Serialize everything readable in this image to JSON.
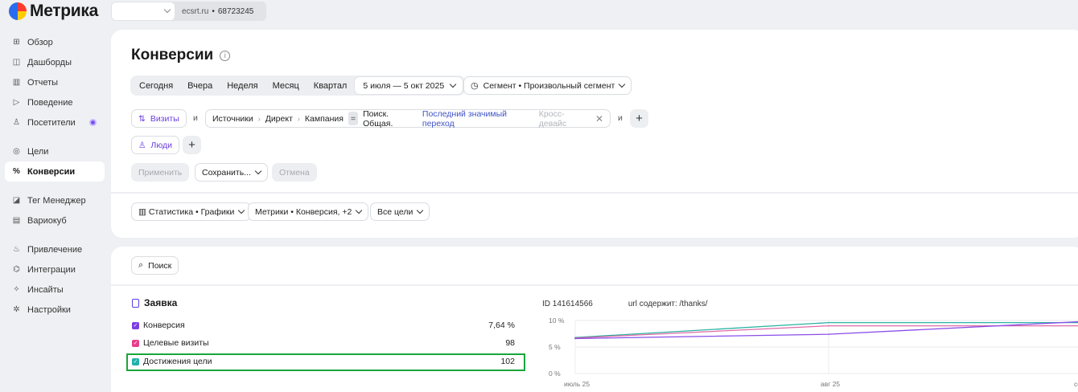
{
  "app": {
    "title": "Метрика"
  },
  "counter": {
    "site": "ecsrt.ru",
    "id": "68723245"
  },
  "sidebar": {
    "items": [
      {
        "label": "Обзор",
        "icon": "grid-icon"
      },
      {
        "label": "Дашборды",
        "icon": "dashboard-icon"
      },
      {
        "label": "Отчеты",
        "icon": "bar-chart-icon"
      },
      {
        "label": "Поведение",
        "icon": "play-icon"
      },
      {
        "label": "Посетители",
        "icon": "user-icon"
      },
      {
        "label": "Цели",
        "icon": "target-icon"
      },
      {
        "label": "Конверсии",
        "icon": "percent-icon",
        "active": true
      },
      {
        "label": "Тег Менеджер",
        "icon": "tag-icon"
      },
      {
        "label": "Вариокуб",
        "icon": "cube-icon"
      },
      {
        "label": "Привлечение",
        "icon": "fire-icon"
      },
      {
        "label": "Интеграции",
        "icon": "puzzle-icon"
      },
      {
        "label": "Инсайты",
        "icon": "sparkle-icon"
      },
      {
        "label": "Настройки",
        "icon": "gear-icon"
      }
    ]
  },
  "header": {
    "title": "Конверсии"
  },
  "period": {
    "buttons": [
      "Сегодня",
      "Вчера",
      "Неделя",
      "Месяц",
      "Квартал"
    ],
    "range": "5 июля — 5 окт 2025",
    "segment": "Сегмент • Произвольный сегмент"
  },
  "filters": {
    "visits_label": "Визиты",
    "and": "и",
    "path": [
      "Источники",
      "Директ",
      "Кампания"
    ],
    "eq": "=",
    "value": "Поиск. Общая.",
    "attribution": "Последний значимый переход",
    "cross_device": "Кросс-девайс",
    "people_label": "Люди"
  },
  "actions": {
    "apply": "Применить",
    "save": "Сохранить...",
    "cancel": "Отмена"
  },
  "view": {
    "stats": "Статистика • Графики",
    "metrics": "Метрики • Конверсия, +2",
    "goals": "Все цели"
  },
  "search": {
    "label": "Поиск"
  },
  "goal": {
    "title": "Заявка",
    "id_label": "ID 141614566",
    "condition": "url содержит: /thanks/",
    "metrics": [
      {
        "label": "Конверсия",
        "value": "7,64 %",
        "color": "#7b3fe4"
      },
      {
        "label": "Целевые визиты",
        "value": "98",
        "color": "#e83e8c"
      },
      {
        "label": "Достижения цели",
        "value": "102",
        "color": "#20b2aa"
      }
    ]
  },
  "chart_data": {
    "type": "line",
    "x": [
      "июль 25",
      "авг 25",
      "сен"
    ],
    "y_ticks": [
      "10 %",
      "5 %",
      "0 %"
    ],
    "ylim": [
      0,
      10
    ],
    "series": [
      {
        "color": "#2bb3a3",
        "values": [
          6.8,
          9.6,
          9.6
        ]
      },
      {
        "color": "#e06aa7",
        "values": [
          6.7,
          9.0,
          9.0
        ]
      },
      {
        "color": "#8a4de8",
        "values": [
          6.6,
          7.4,
          9.8
        ]
      }
    ]
  }
}
